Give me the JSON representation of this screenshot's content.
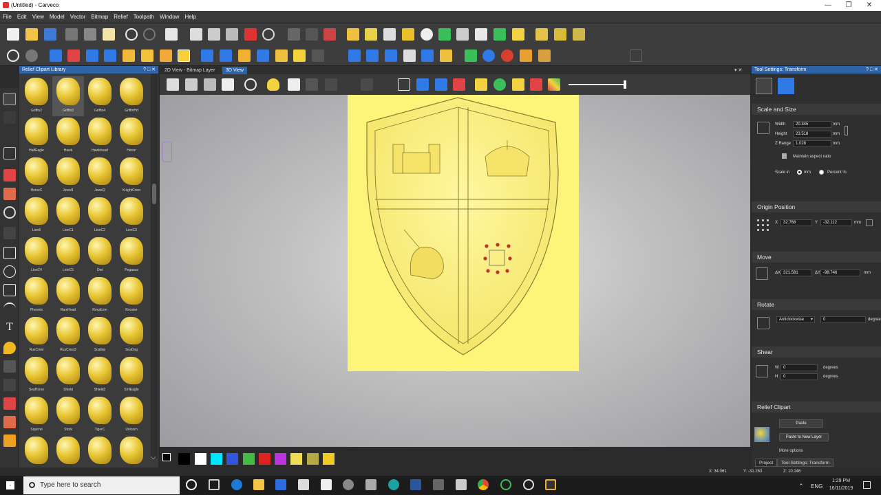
{
  "window": {
    "title": "(Untitled) - Carveco",
    "minimize": "—",
    "restore": "❐",
    "close": "✕"
  },
  "menu": [
    "File",
    "Edit",
    "View",
    "Model",
    "Vector",
    "Bitmap",
    "Relief",
    "Toolpath",
    "Window",
    "Help"
  ],
  "library": {
    "title": "Relief Clipart Library",
    "items": [
      "Griffin2",
      "Griffin3",
      "Griffin4",
      "GriffinHd",
      "HalfEagle",
      "Hawk",
      "Hawkhead",
      "Heron",
      "HorseC",
      "Jewel1",
      "Jewel2",
      "KnightCrest",
      "Lion6",
      "LionC1",
      "LionC2",
      "LionC3",
      "LionC4",
      "LionC5",
      "Owl",
      "Pegasus",
      "Pheonix",
      "RamHead",
      "RmptLion",
      "Rooster",
      "RusCrest",
      "RusCrest2",
      "Scallop",
      "SeaDog",
      "SeaHorse",
      "Shield",
      "Shield2",
      "SmlEagle",
      "Squirrel",
      "Stork",
      "TigerC",
      "Unicorn",
      "",
      "",
      "",
      ""
    ],
    "selected": "Griffin3"
  },
  "view_tabs": {
    "tab1": "2D View - Bitmap Layer",
    "tab2": "3D View"
  },
  "palette": [
    "#000000",
    "#000000",
    "#ffffff",
    "#00e5ff",
    "#3355dd",
    "#44bb44",
    "#dd2222",
    "#bb33dd",
    "#eedd55",
    "#b4a944",
    "#eecc22"
  ],
  "panel": {
    "title": "Tool Settings: Transform",
    "scale_size": {
      "heading": "Scale and Size",
      "width_label": "Width",
      "width": "20.345",
      "height_label": "Height",
      "height": "23.518",
      "zrange_label": "Z Range",
      "zrange": "1.028",
      "unit": "mm",
      "maintain": "Maintain aspect ratio",
      "scale_in": "Scale in",
      "mm": "mm",
      "percent": "Percent %"
    },
    "origin": {
      "heading": "Origin Position",
      "x_label": "X",
      "x": "32.768",
      "y_label": "Y",
      "y": "-32.112",
      "unit": "mm"
    },
    "move": {
      "heading": "Move",
      "dx_label": "ΔX",
      "dx": "321.581",
      "dy_label": "ΔY",
      "dy": "-98.746",
      "unit": "mm"
    },
    "rotate": {
      "heading": "Rotate",
      "direction": "Anticlockwise",
      "angle": "0",
      "unit": "degrees"
    },
    "shear": {
      "heading": "Shear",
      "w_label": "W",
      "w": "0",
      "h_label": "H",
      "h": "0",
      "unit": "degrees"
    },
    "clipart": {
      "heading": "Relief Clipart",
      "paste": "Paste",
      "paste_new": "Paste to New Layer",
      "more": "More options"
    }
  },
  "bottom_tabs": {
    "project": "Project",
    "tool": "Tool Settings: Transform"
  },
  "status": {
    "x": "X: 34.061",
    "y": "Y: -31.263",
    "z": "Z: 10.246"
  },
  "taskbar": {
    "search": "Type here to search",
    "lang": "ENG",
    "time": "1:29 PM",
    "date": "16/11/2019"
  }
}
